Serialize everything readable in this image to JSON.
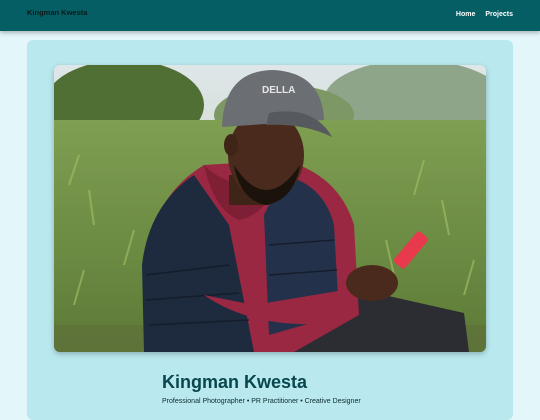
{
  "navbar": {
    "brand": "Kingman Kwesta",
    "links": [
      "Home",
      "Projects"
    ]
  },
  "profile": {
    "name": "Kingman Kwesta",
    "tagline": "Professional Photographer • PR Practitioner • Creative Designer",
    "cap_text": "DELLA"
  },
  "colors": {
    "navbar": "#045e63",
    "page_background": "#e3f6fa",
    "card_background": "#b9e9ef",
    "name_text": "#07474d"
  }
}
